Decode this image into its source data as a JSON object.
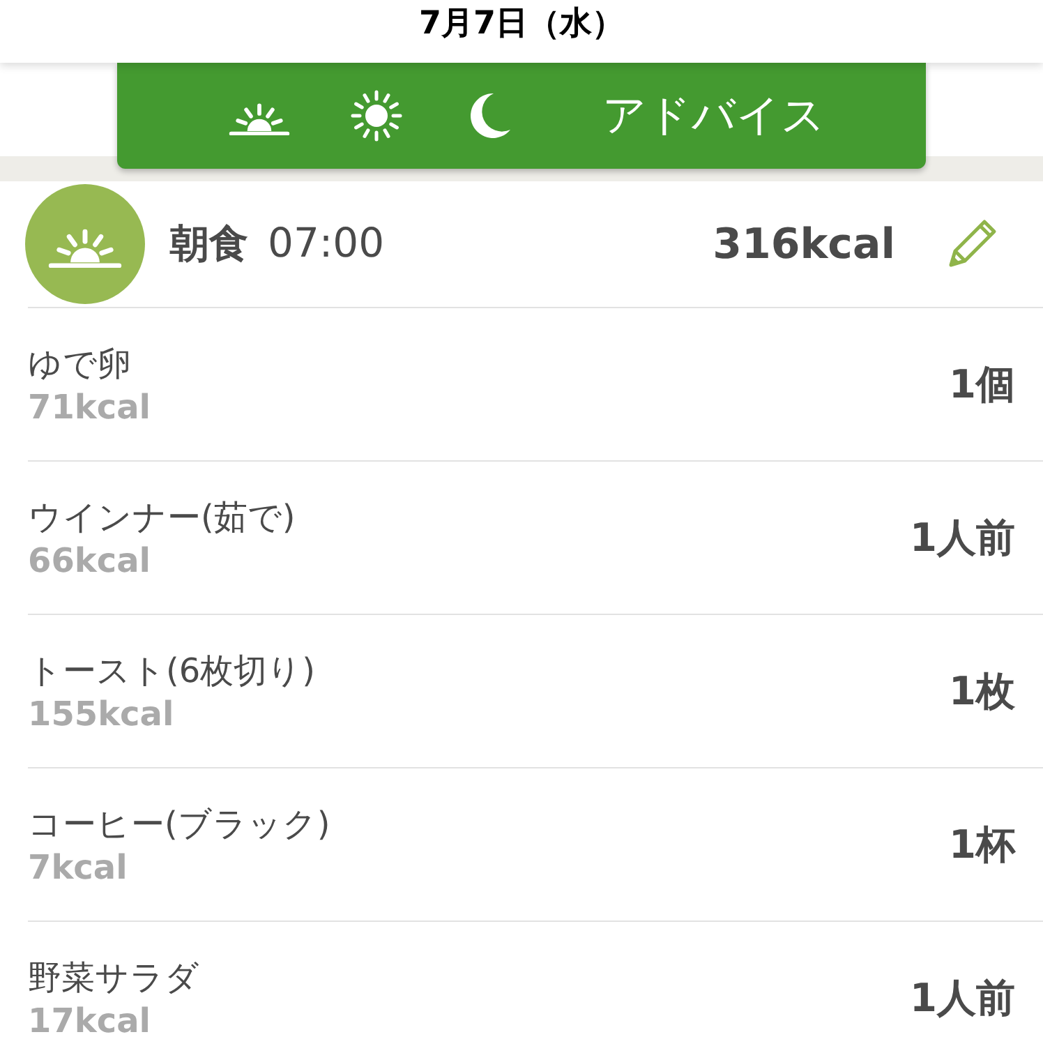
{
  "header": {
    "title": "7月7日（水）"
  },
  "meal_tabs": [
    {
      "kind": "sunrise"
    },
    {
      "kind": "sun"
    },
    {
      "kind": "moon"
    },
    {
      "kind": "text",
      "label": "アドバイス"
    }
  ],
  "meal": {
    "kind": "sunrise",
    "name": "朝食",
    "time": "07:00",
    "total": "316kcal",
    "items": [
      {
        "name": "ゆで卵",
        "kcal": "71kcal",
        "amount": "1個"
      },
      {
        "name": "ウインナー(茹で)",
        "kcal": "66kcal",
        "amount": "1人前"
      },
      {
        "name": "トースト(6枚切り)",
        "kcal": "155kcal",
        "amount": "1枚"
      },
      {
        "name": "コーヒー(ブラック)",
        "kcal": "7kcal",
        "amount": "1杯"
      },
      {
        "name": "野菜サラダ",
        "kcal": "17kcal",
        "amount": "1人前"
      }
    ]
  }
}
